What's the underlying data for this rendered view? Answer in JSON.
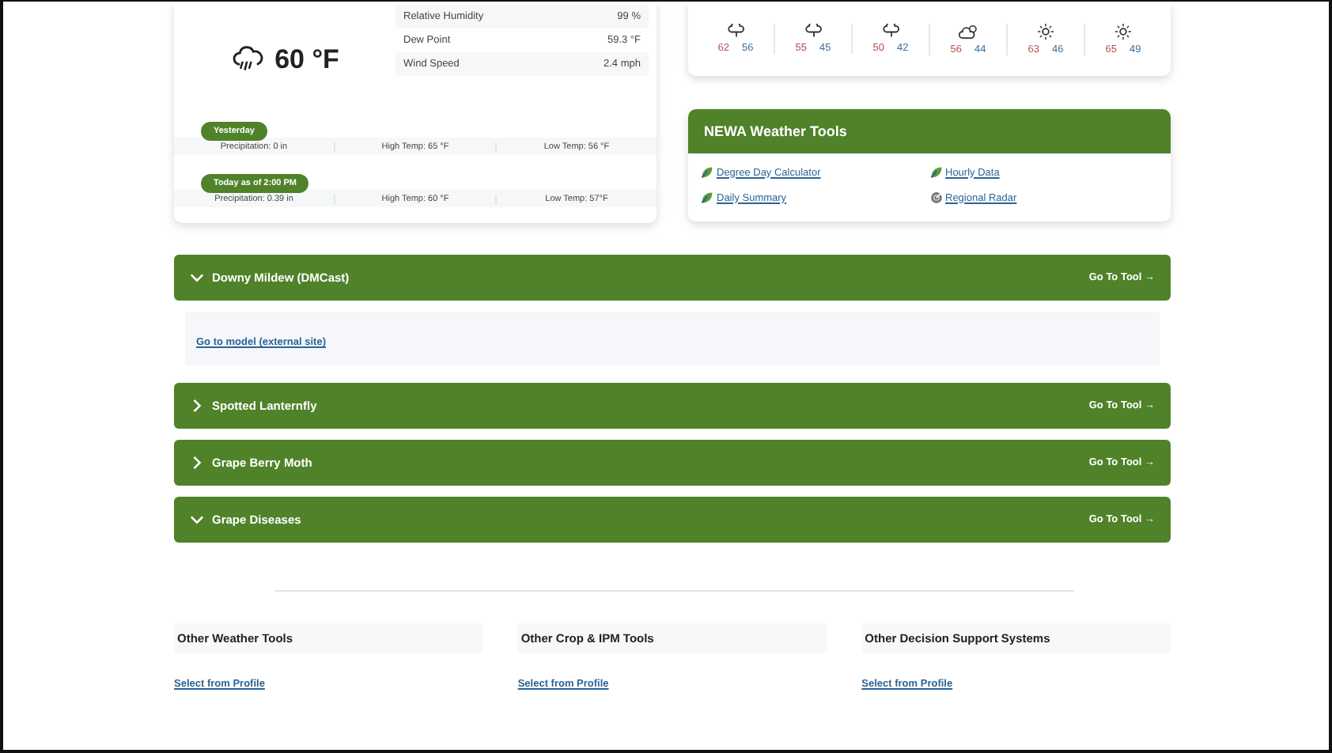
{
  "current": {
    "kind": "rain",
    "temperature": "60 °F",
    "stats": [
      {
        "label": "Relative Humidity",
        "value": "99 %"
      },
      {
        "label": "Dew Point",
        "value": "59.3 °F"
      },
      {
        "label": "Wind Speed",
        "value": "2.4 mph"
      }
    ],
    "summaries": [
      {
        "badge": "Yesterday",
        "items": [
          "Precipitation: 0 in",
          "High Temp: 65 °F",
          "Low Temp: 56 °F"
        ]
      },
      {
        "badge": "Today as of 2:00 PM",
        "items": [
          "Precipitation: 0.39 in",
          "High Temp: 60 °F",
          "Low Temp: 57°F"
        ]
      }
    ]
  },
  "forecast": [
    {
      "kind": "rain",
      "high": "62",
      "low": "56"
    },
    {
      "kind": "rain",
      "high": "55",
      "low": "45"
    },
    {
      "kind": "rain",
      "high": "50",
      "low": "42"
    },
    {
      "kind": "partly-cloudy",
      "high": "56",
      "low": "44"
    },
    {
      "kind": "sunny",
      "high": "63",
      "low": "46"
    },
    {
      "kind": "sunny",
      "high": "65",
      "low": "49"
    }
  ],
  "weather_tools": {
    "title": "NEWA Weather Tools",
    "links": [
      {
        "label": "Degree Day Calculator",
        "kind": "leaf"
      },
      {
        "label": "Hourly Data",
        "kind": "leaf"
      },
      {
        "label": "Daily Summary",
        "kind": "leaf"
      },
      {
        "label": "Regional Radar",
        "kind": "radar"
      }
    ]
  },
  "models": [
    {
      "title": "Downy Mildew (DMCast)",
      "expanded": true,
      "action": "Go To Tool →",
      "content_link": "Go to model (external site)"
    },
    {
      "title": "Spotted Lanternfly",
      "expanded": false,
      "action": "Go To Tool →"
    },
    {
      "title": "Grape Berry Moth",
      "expanded": false,
      "action": "Go To Tool →"
    },
    {
      "title": "Grape Diseases",
      "expanded": true,
      "action": "Go To Tool →"
    }
  ],
  "other_sections": [
    {
      "title": "Other Weather Tools",
      "link": "Select from Profile"
    },
    {
      "title": "Other Crop & IPM Tools",
      "link": "Select from Profile"
    },
    {
      "title": "Other Decision Support Systems",
      "link": "Select from Profile"
    }
  ]
}
